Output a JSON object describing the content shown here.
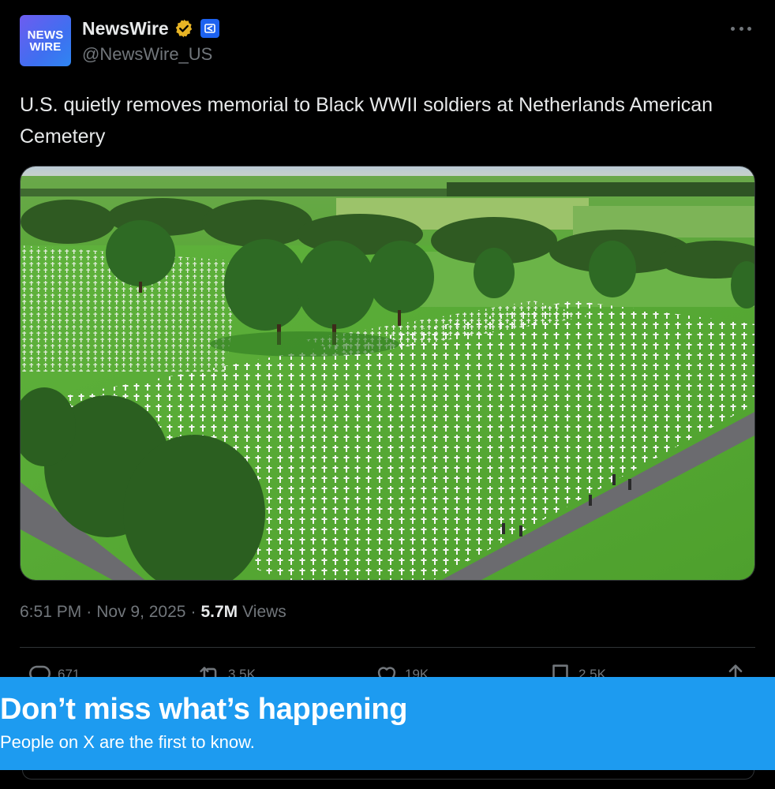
{
  "account": {
    "avatar_lines": [
      "NEWS",
      "WIRE"
    ],
    "display_name": "NewsWire",
    "handle": "@NewsWire_US",
    "verified_icon": "gold-verified-badge-icon",
    "affiliate_icon": "affiliate-badge-icon"
  },
  "tweet": {
    "text": "U.S. quietly removes memorial to Black WWII soldiers at Netherlands American Cemetery",
    "media_icon": "cemetery-photo"
  },
  "meta": {
    "time": "6:51 PM",
    "separator": "·",
    "date": "Nov 9, 2025",
    "views_count": "5.7M",
    "views_label": "Views"
  },
  "actions": {
    "reply_count": "671",
    "repost_count": "3.5K",
    "like_count": "19K",
    "bookmark_count": "2.5K"
  },
  "banner": {
    "title": "Don’t miss what’s happening",
    "subtitle": "People on X are the first to know."
  },
  "colors": {
    "background": "#000000",
    "banner": "#1d9bf0",
    "muted": "#71767b",
    "text": "#e7e9ea",
    "verified_gold": "#e8b425"
  }
}
